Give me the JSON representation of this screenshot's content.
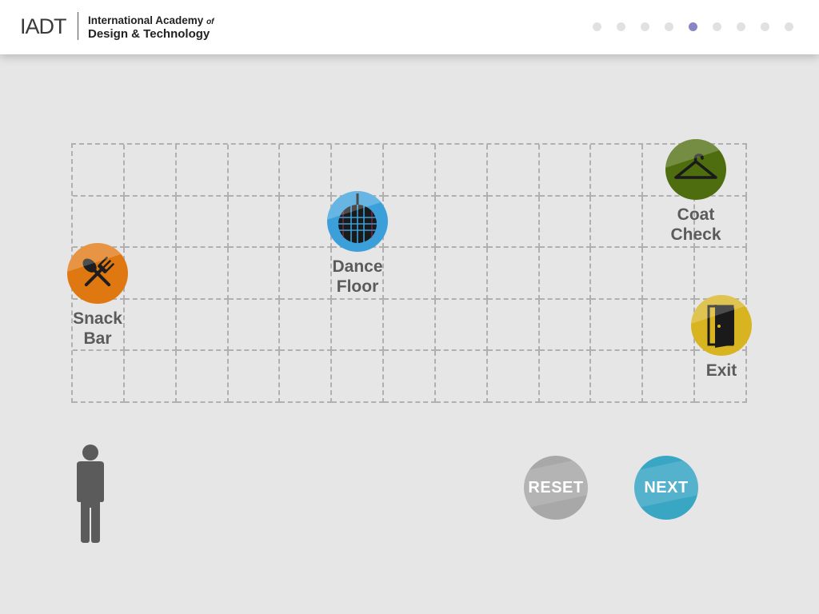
{
  "header": {
    "logo_abbr": "IADT",
    "logo_line1": "International Academy",
    "logo_of": "of",
    "logo_line2": "Design & Technology",
    "progress": {
      "total_steps": 9,
      "current_step": 5
    }
  },
  "floor_plan": {
    "columns": 13,
    "rows": 5,
    "stations": [
      {
        "id": "snack-bar",
        "label": "Snack\nBar",
        "icon": "utensils-icon",
        "color": "#e07811"
      },
      {
        "id": "dance-floor",
        "label": "Dance\nFloor",
        "icon": "disco-ball-icon",
        "color": "#3ba0da"
      },
      {
        "id": "coat-check",
        "label": "Coat\nCheck",
        "icon": "hanger-icon",
        "color": "#4e6d0e"
      },
      {
        "id": "exit",
        "label": "Exit",
        "icon": "door-icon",
        "color": "#d8b421"
      }
    ]
  },
  "person": {
    "icon": "person-icon"
  },
  "buttons": {
    "reset": "RESET",
    "next": "NEXT"
  },
  "colors": {
    "accent_active_dot": "#8a85c4",
    "next": "#39a6c4",
    "reset": "#a8a8a8"
  }
}
